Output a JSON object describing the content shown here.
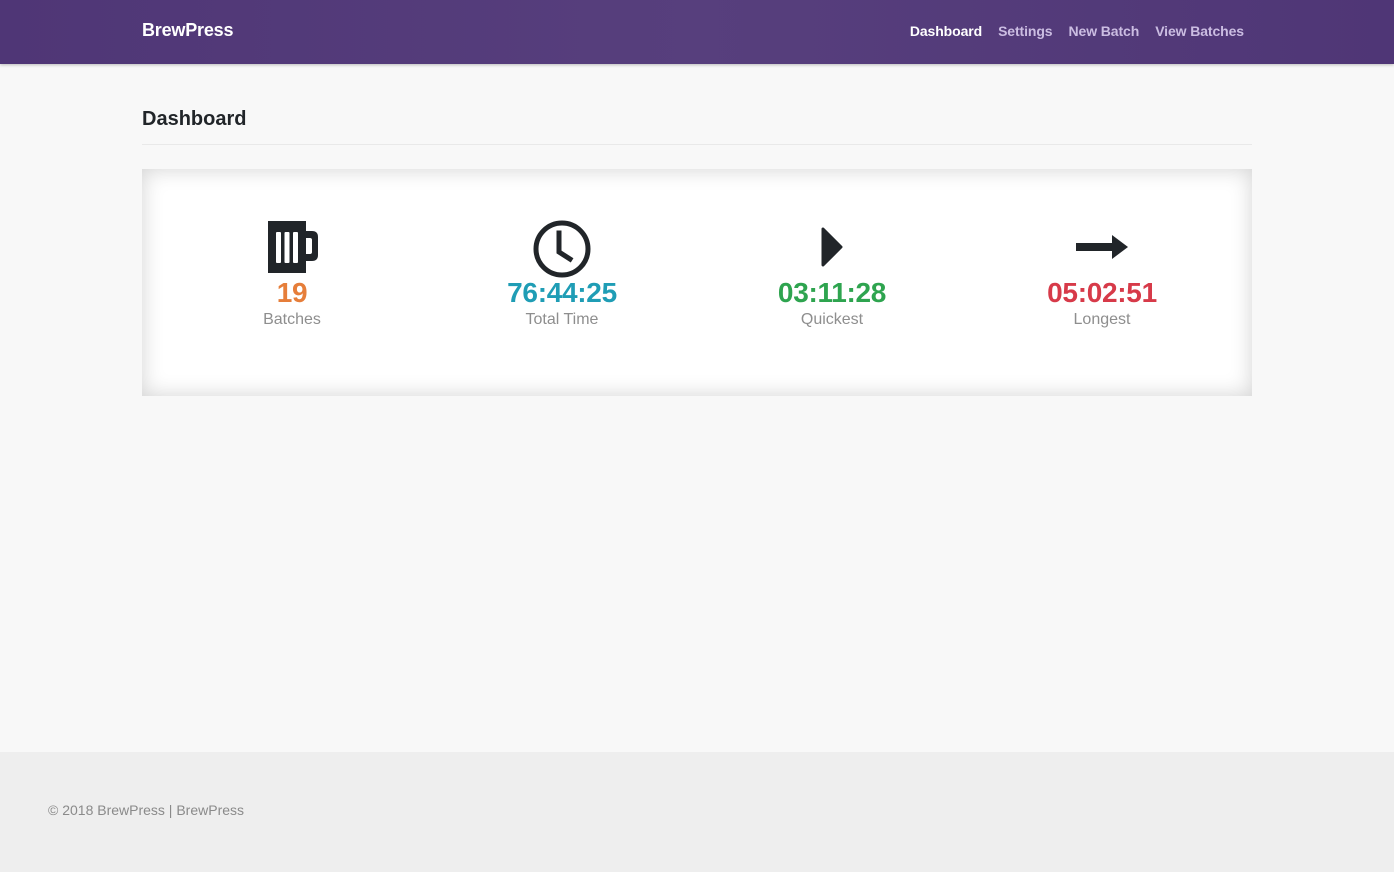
{
  "app": {
    "brand": "BrewPress"
  },
  "nav": {
    "items": [
      {
        "label": "Dashboard",
        "active": true
      },
      {
        "label": "Settings",
        "active": false
      },
      {
        "label": "New Batch",
        "active": false
      },
      {
        "label": "View Batches",
        "active": false
      }
    ]
  },
  "page": {
    "title": "Dashboard"
  },
  "stats": [
    {
      "icon": "beer-mug-icon",
      "value": "19",
      "label": "Batches",
      "color": "#e67e3a"
    },
    {
      "icon": "clock-icon",
      "value": "76:44:25",
      "label": "Total Time",
      "color": "#1f9db5"
    },
    {
      "icon": "play-icon",
      "value": "03:11:28",
      "label": "Quickest",
      "color": "#2ea44f"
    },
    {
      "icon": "arrow-right-icon",
      "value": "05:02:51",
      "label": "Longest",
      "color": "#d73a49"
    }
  ],
  "footer": {
    "text": "© 2018 BrewPress | BrewPress"
  },
  "colors": {
    "navbar": "#563d7c",
    "icon": "#212529"
  }
}
